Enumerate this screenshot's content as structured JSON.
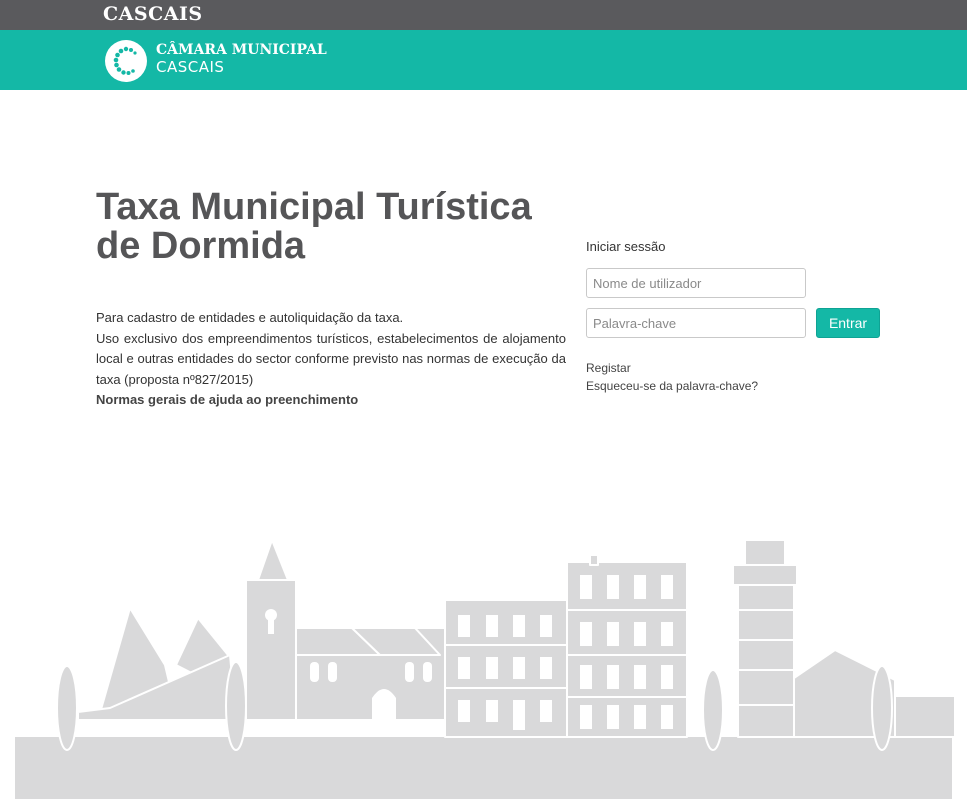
{
  "topbar": {
    "brand": "CASCAIS"
  },
  "brand": {
    "line1": "CÂMARA MUNICIPAL",
    "line2": "CASCAIS"
  },
  "main": {
    "title": "Taxa Municipal Turística de Dormida",
    "description_line1": "Para cadastro de entidades e autoliquidação da taxa.",
    "description_line2": "Uso exclusivo dos empreendimentos turísticos, estabelecimentos de alojamento local e outras entidades do sector conforme previsto nas normas de execução da taxa (proposta nº827/2015)",
    "help_link": "Normas gerais de ajuda ao preenchimento"
  },
  "login": {
    "title": "Iniciar sessão",
    "username_placeholder": "Nome de utilizador",
    "password_placeholder": "Palavra-chave",
    "submit_label": "Entrar",
    "register_link": "Registar",
    "forgot_link": "Esqueceu-se da palavra-chave?"
  },
  "colors": {
    "topbar": "#5a5a5d",
    "brand_teal": "#14b8a6",
    "skyline_fill": "#d9d9da"
  },
  "icons": {
    "logo": "cascais-c-logo-icon",
    "skyline": "city-skyline-illustration"
  }
}
